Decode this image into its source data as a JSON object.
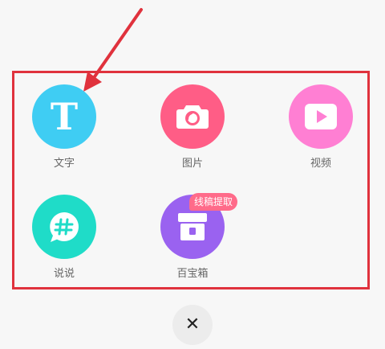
{
  "menu": {
    "items": [
      {
        "label": "文字",
        "icon": "text-icon",
        "color": "#3fcdf3"
      },
      {
        "label": "图片",
        "icon": "camera-icon",
        "color": "#ff5d86"
      },
      {
        "label": "视频",
        "icon": "video-play-icon",
        "color": "#ff7fd3"
      },
      {
        "label": "说说",
        "icon": "hashtag-chat-icon",
        "color": "#1fdcc8"
      },
      {
        "label": "百宝箱",
        "icon": "treasure-box-icon",
        "color": "#9a62f0",
        "badge": "线稿提取"
      }
    ]
  },
  "text_icon_glyph": "T",
  "close_glyph": "✕",
  "annotation_color": "#e0323d"
}
